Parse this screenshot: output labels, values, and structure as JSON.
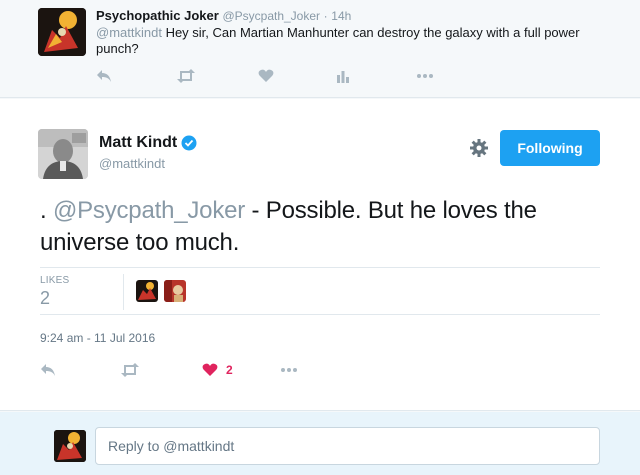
{
  "parent_tweet": {
    "name": "Psychopathic Joker",
    "handle": "@Psycpath_Joker",
    "separator": "·",
    "time": "14h",
    "mention": "@mattkindt",
    "text": " Hey sir, Can Martian Manhunter can destroy the galaxy with a full power punch?",
    "avatar_icon": "joker-avatar"
  },
  "main_tweet": {
    "name": "Matt Kindt",
    "handle": "@mattkindt",
    "verified_icon": "verified-badge-icon",
    "follow_label": "Following",
    "text_prefix": ". ",
    "mention": "@Psycpath_Joker",
    "text_suffix": " - Possible. But he loves the universe too much.",
    "likes_label": "LIKES",
    "likes_count": "2",
    "timestamp": "9:24 am - 11 Jul 2016",
    "like_action_count": "2",
    "avatar_icon": "matt-kindt-avatar"
  },
  "reply": {
    "placeholder": "Reply to @mattkindt"
  },
  "colors": {
    "accent": "#1da1f2",
    "like": "#e0245e",
    "muted": "#8899a6",
    "icon": "#aab8c2"
  }
}
